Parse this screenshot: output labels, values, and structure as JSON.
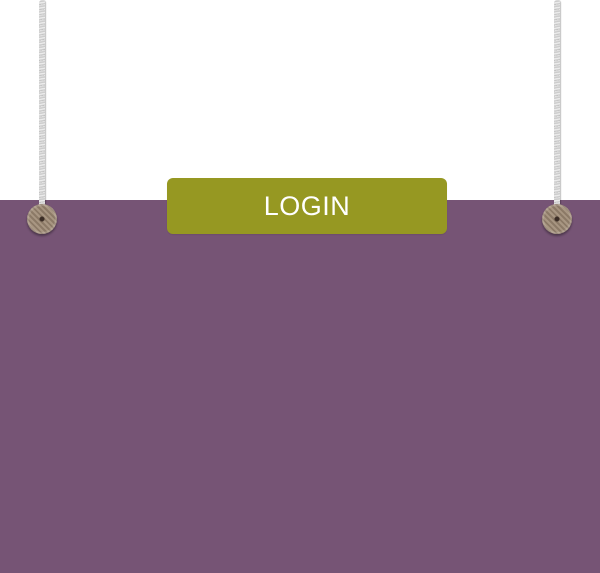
{
  "login": {
    "label": "LOGIN"
  },
  "colors": {
    "background": "#ffffff",
    "panel": "#765475",
    "button": "#969822",
    "button_text": "#ffffff"
  },
  "icons": {
    "left_rope": "rope-icon",
    "right_rope": "rope-icon",
    "left_knob": "knob-icon",
    "right_knob": "knob-icon"
  }
}
